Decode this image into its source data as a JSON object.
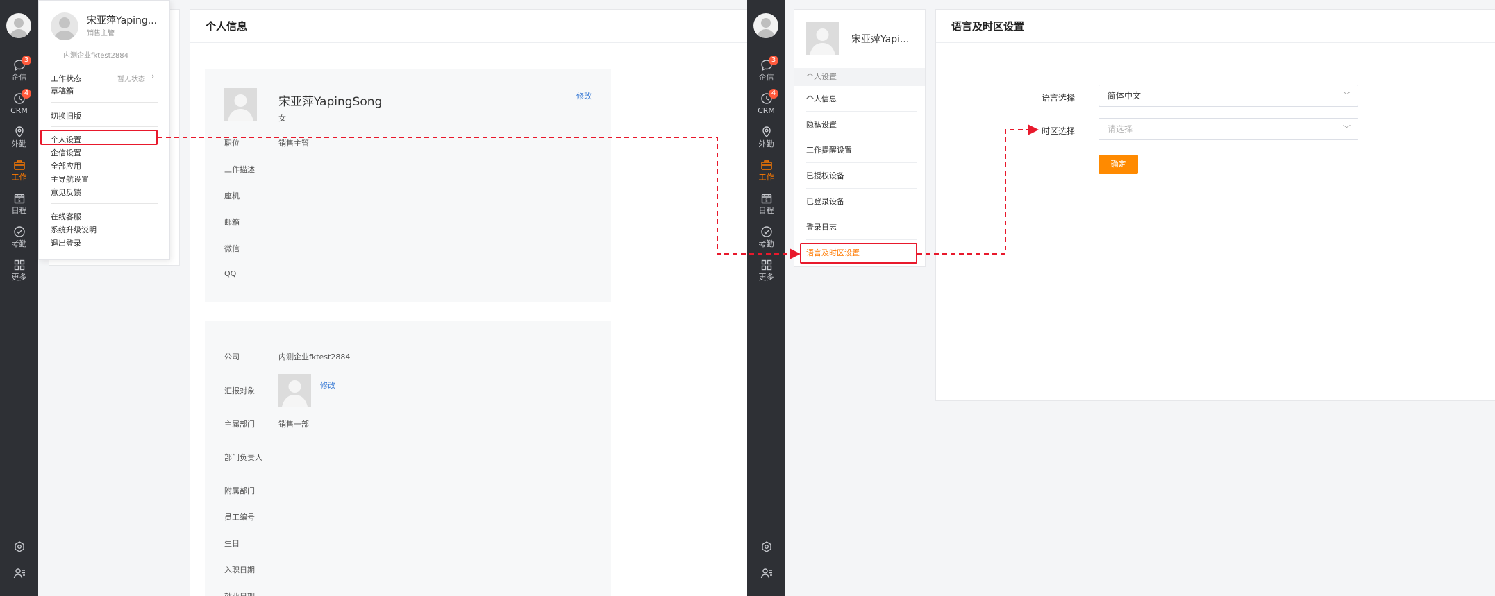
{
  "colors": {
    "accent": "#ff7a00",
    "annotation": "#e8192c",
    "link": "#3a7bd5",
    "badge": "#ff5a3c"
  },
  "sidebar": {
    "items": [
      {
        "label": "企信",
        "icon": "chat-icon",
        "badge": "3"
      },
      {
        "label": "CRM",
        "icon": "clock-icon",
        "badge": "4"
      },
      {
        "label": "外勤",
        "icon": "location-icon"
      },
      {
        "label": "工作",
        "icon": "briefcase-icon"
      },
      {
        "label": "日程",
        "icon": "calendar-icon",
        "day": "5"
      },
      {
        "label": "考勤",
        "icon": "check-circle-icon"
      },
      {
        "label": "更多",
        "icon": "grid-icon"
      }
    ],
    "bottom_icons": [
      "settings-icon",
      "user-list-icon"
    ]
  },
  "left": {
    "dropdown": {
      "user_name": "宋亚萍Yaping...",
      "user_role": "销售主管",
      "company": "内测企业fktest2884",
      "status_label": "工作状态",
      "status_value": "暂无状态",
      "drafts": "草稿箱",
      "switch_old": "切换旧版",
      "personal_settings": "个人设置",
      "enterprise_settings": "企信设置",
      "all_apps": "全部应用",
      "main_nav_settings": "主导航设置",
      "feedback": "意见反馈",
      "online_service": "在线客服",
      "upgrade_notes": "系统升级说明",
      "logout": "退出登录"
    },
    "profile": {
      "title": "个人信息",
      "name": "宋亚萍YapingSong",
      "gender": "女",
      "edit": "修改",
      "fields": [
        {
          "label": "职位",
          "value": "销售主管"
        },
        {
          "label": "工作描述",
          "value": ""
        },
        {
          "label": "座机",
          "value": ""
        },
        {
          "label": "邮箱",
          "value": ""
        },
        {
          "label": "微信",
          "value": ""
        },
        {
          "label": "QQ",
          "value": ""
        }
      ],
      "org": {
        "company_label": "公司",
        "company_value": "内测企业fktest2884",
        "report_label": "汇报对象",
        "report_edit": "修改",
        "dept_label": "主属部门",
        "dept_value": "销售一部",
        "dept_head_label": "部门负责人",
        "sub_dept_label": "附属部门",
        "emp_no_label": "员工编号",
        "birthday_label": "生日",
        "join_date_label": "入职日期",
        "employ_date_label": "就业日期"
      }
    }
  },
  "right": {
    "user_name": "宋亚萍Yapi...",
    "section_title": "个人设置",
    "settings_items": [
      "个人信息",
      "隐私设置",
      "工作提醒设置",
      "已授权设备",
      "已登录设备",
      "登录日志",
      "语言及时区设置"
    ],
    "page_title": "语言及时区设置",
    "language_label": "语言选择",
    "language_value": "简体中文",
    "timezone_label": "时区选择",
    "timezone_placeholder": "请选择",
    "confirm": "确定"
  }
}
